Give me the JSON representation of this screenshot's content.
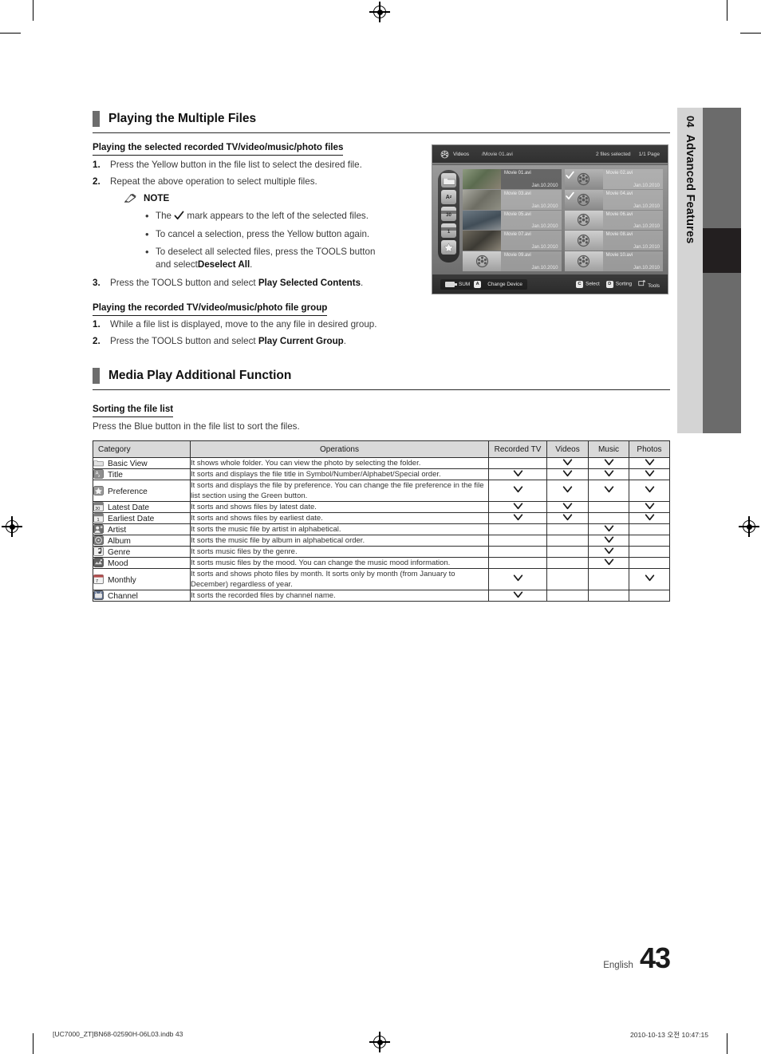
{
  "chapter": {
    "number": "04",
    "title": "Advanced Features"
  },
  "sections": [
    {
      "id": "multi",
      "title": "Playing the Multiple Files"
    },
    {
      "id": "addfn",
      "title": "Media Play Additional Function"
    }
  ],
  "sub_selected": {
    "heading": "Playing the selected recorded TV/video/music/photo files",
    "steps": [
      {
        "n": "1.",
        "text": "Press the Yellow button in the file list to select the desired file."
      },
      {
        "n": "2.",
        "text": "Repeat the above operation to select multiple files."
      },
      {
        "n": "3.",
        "text_pre": "Press the TOOLS button and select ",
        "bold": "Play Selected Contents",
        "text_post": "."
      }
    ],
    "note_label": "NOTE",
    "note_icon": "pencil-icon",
    "bullets": [
      {
        "pre": "The ",
        "icon": "check-icon",
        "post": " mark appears to the left of the selected files."
      },
      {
        "pre": "To cancel a selection, press the Yellow button again."
      },
      {
        "pre": "To deselect all selected files, press the TOOLS button",
        "line2_pre": "and select ",
        "bold": "Deselect All",
        "line2_post": "."
      }
    ]
  },
  "sub_group": {
    "heading": "Playing the recorded TV/video/music/photo file group",
    "steps": [
      {
        "n": "1.",
        "text": "While a file list is displayed, move to the any file in desired group."
      },
      {
        "n": "2.",
        "text_pre": "Press the TOOLS button and select ",
        "bold": "Play Current Group",
        "text_post": "."
      }
    ]
  },
  "sub_sorting": {
    "heading": "Sorting the file list",
    "paragraph": "Press the Blue button in the file list to sort the files."
  },
  "tv_screen": {
    "header": {
      "mode_icon": "film-reel-icon",
      "mode": "Videos",
      "path": "/Movie 01.avi",
      "selected_count": "2 files selected",
      "page": "1/1 Page"
    },
    "side_icons": [
      "folder-icon",
      "a-z-icon",
      "calendar-30-icon",
      "calendar-1-icon",
      "star-icon"
    ],
    "files": [
      {
        "name": "Movie 01.avi",
        "date": "Jan.10.2010",
        "selected": false,
        "highlighted": true,
        "thumb": "photo-a",
        "check": false
      },
      {
        "name": "Movie 02.avi",
        "date": "Jan.10.2010",
        "selected": true,
        "highlighted": true,
        "thumb": "icon",
        "check": true
      },
      {
        "name": "Movie 03.avi",
        "date": "Jan.10.2010",
        "selected": false,
        "highlighted": false,
        "thumb": "photo-b",
        "check": false
      },
      {
        "name": "Movie 04.avi",
        "date": "Jan.10.2010",
        "selected": true,
        "highlighted": true,
        "thumb": "icon",
        "check": true
      },
      {
        "name": "Movie 05.avi",
        "date": "Jan.10.2010",
        "selected": false,
        "highlighted": false,
        "thumb": "photo-c",
        "check": false
      },
      {
        "name": "Movie 06.avi",
        "date": "Jan.10.2010",
        "selected": false,
        "highlighted": false,
        "thumb": "icon",
        "check": false
      },
      {
        "name": "Movie 07.avi",
        "date": "Jan.10.2010",
        "selected": false,
        "highlighted": false,
        "thumb": "photo-d",
        "check": false
      },
      {
        "name": "Movie 08.avi",
        "date": "Jan.10.2010",
        "selected": false,
        "highlighted": false,
        "thumb": "icon",
        "check": false
      },
      {
        "name": "Movie 09.avi",
        "date": "Jan.10.2010",
        "selected": false,
        "highlighted": false,
        "thumb": "icon",
        "check": false
      },
      {
        "name": "Movie 10.avi",
        "date": "Jan.10.2010",
        "selected": false,
        "highlighted": false,
        "thumb": "icon",
        "check": false
      }
    ],
    "footer": {
      "device_icon": "usb-icon",
      "device_label": "SUM",
      "change_device_key": "A",
      "change_device_label": "Change Device",
      "select_key": "C",
      "select_label": "Select",
      "sorting_key": "D",
      "sorting_label": "Sorting",
      "tools_icon": "tools-icon",
      "tools_label": "Tools"
    }
  },
  "table": {
    "headers": [
      "Category",
      "Operations",
      "Recorded TV",
      "Videos",
      "Music",
      "Photos"
    ],
    "rows": [
      {
        "icon": "folder-icon",
        "category": "Basic View",
        "operations": "It shows whole folder. You can view the photo by selecting the folder.",
        "marks": [
          false,
          true,
          true,
          true
        ]
      },
      {
        "icon": "a-z-icon",
        "category": "Title",
        "operations": "It sorts and displays the file title in Symbol/Number/Alphabet/Special order.",
        "marks": [
          true,
          true,
          true,
          true
        ]
      },
      {
        "icon": "star-icon",
        "category": "Preference",
        "operations": "It sorts and displays the file by preference. You can change the file preference in the file list section using the Green button.",
        "marks": [
          true,
          true,
          true,
          true
        ]
      },
      {
        "icon": "calendar-30-icon",
        "category": "Latest Date",
        "operations": "It sorts and shows files by latest date.",
        "marks": [
          true,
          true,
          false,
          true
        ]
      },
      {
        "icon": "calendar-1-icon",
        "category": "Earliest Date",
        "operations": "It sorts and shows files by earliest date.",
        "marks": [
          true,
          true,
          false,
          true
        ]
      },
      {
        "icon": "artist-icon",
        "category": "Artist",
        "operations": "It sorts the music file by artist in alphabetical.",
        "marks": [
          false,
          false,
          true,
          false
        ]
      },
      {
        "icon": "album-icon",
        "category": "Album",
        "operations": "It sorts the music file by album in alphabetical order.",
        "marks": [
          false,
          false,
          true,
          false
        ]
      },
      {
        "icon": "genre-icon",
        "category": "Genre",
        "operations": "It sorts music files by the genre.",
        "marks": [
          false,
          false,
          true,
          false
        ]
      },
      {
        "icon": "mood-icon",
        "category": "Mood",
        "operations": "It sorts music files by the mood. You can change the music mood information.",
        "marks": [
          false,
          false,
          true,
          false
        ]
      },
      {
        "icon": "calendar-7-icon",
        "category": "Monthly",
        "operations": "It sorts and shows photo files by month. It sorts only by month (from January to December) regardless of year.",
        "marks": [
          true,
          false,
          false,
          true
        ]
      },
      {
        "icon": "channel-icon",
        "category": "Channel",
        "operations": "It sorts the recorded files by channel name.",
        "marks": [
          true,
          false,
          false,
          false
        ]
      }
    ]
  },
  "page_footer": {
    "language": "English",
    "page_number": "43",
    "indb": "[UC7000_ZT]BN68-02590H-06L03.indb   43",
    "timestamp": "2010-10-13   오전 10:47:15"
  }
}
